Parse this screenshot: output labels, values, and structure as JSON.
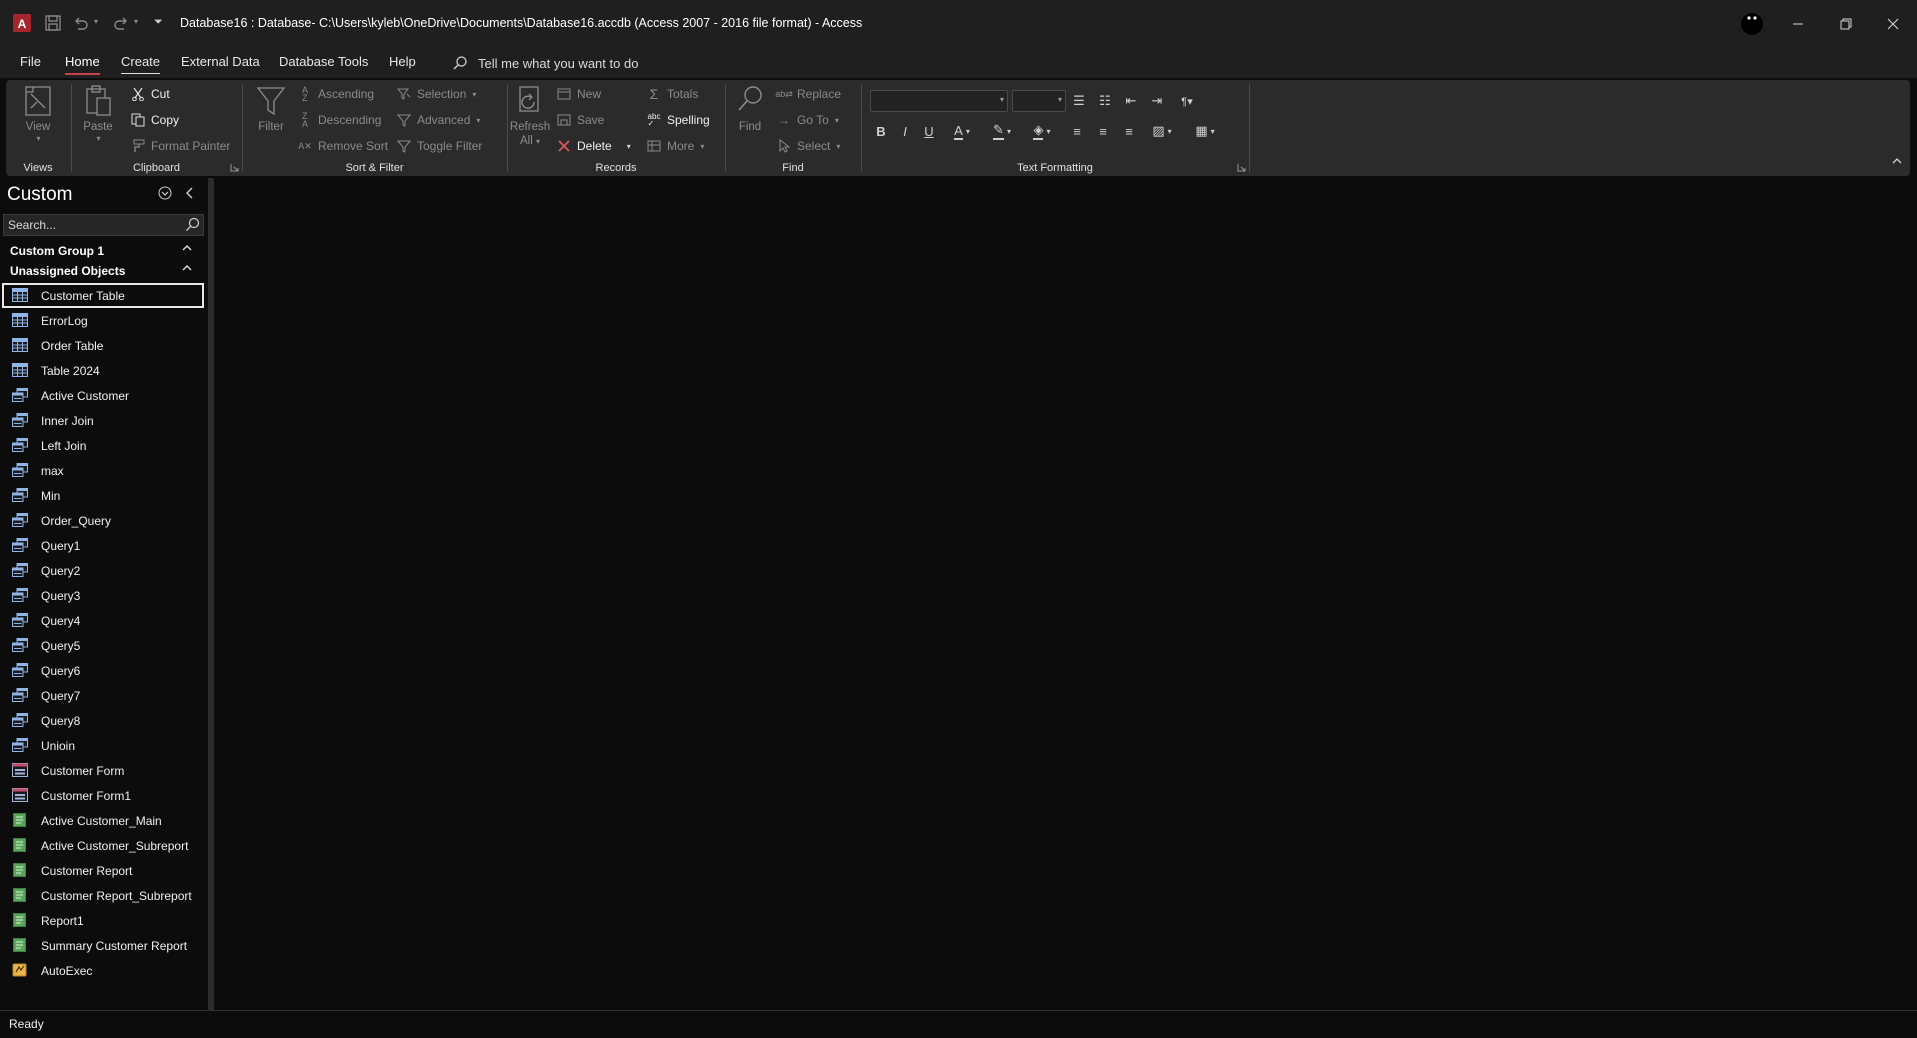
{
  "title_bar": {
    "title": "Database16 : Database- C:\\Users\\kyleb\\OneDrive\\Documents\\Database16.accdb (Access 2007 - 2016 file format)  -  Access"
  },
  "menu_tabs": [
    {
      "label": "File"
    },
    {
      "label": "Home",
      "active": true
    },
    {
      "label": "Create"
    },
    {
      "label": "External Data"
    },
    {
      "label": "Database Tools"
    },
    {
      "label": "Help"
    }
  ],
  "tell_me": {
    "text": "Tell me what you want to do"
  },
  "ribbon": {
    "views": {
      "group_label": "Views",
      "view": "View"
    },
    "clipboard": {
      "group_label": "Clipboard",
      "paste": "Paste",
      "cut": "Cut",
      "copy": "Copy",
      "format_painter": "Format Painter"
    },
    "sort_filter": {
      "group_label": "Sort & Filter",
      "filter": "Filter",
      "ascending": "Ascending",
      "descending": "Descending",
      "remove_sort": "Remove Sort",
      "selection": "Selection",
      "advanced": "Advanced",
      "toggle_filter": "Toggle Filter"
    },
    "records": {
      "group_label": "Records",
      "refresh": "Refresh",
      "refresh_all": "All",
      "new": "New",
      "save": "Save",
      "delete": "Delete",
      "totals": "Totals",
      "spelling": "Spelling",
      "more": "More"
    },
    "find": {
      "group_label": "Find",
      "find": "Find",
      "replace": "Replace",
      "go_to": "Go To",
      "select": "Select"
    },
    "text_formatting": {
      "group_label": "Text Formatting",
      "font_name": "",
      "font_size": ""
    }
  },
  "nav_pane": {
    "title": "Custom",
    "search_placeholder": "Search...",
    "groups": [
      {
        "label": "Custom Group 1"
      },
      {
        "label": "Unassigned Objects"
      }
    ],
    "items": [
      {
        "label": "Customer Table",
        "type": "table",
        "selected": true
      },
      {
        "label": "ErrorLog",
        "type": "table"
      },
      {
        "label": "Order Table",
        "type": "table"
      },
      {
        "label": "Table 2024",
        "type": "table"
      },
      {
        "label": "Active Customer",
        "type": "query"
      },
      {
        "label": "Inner Join",
        "type": "query"
      },
      {
        "label": "Left Join",
        "type": "query"
      },
      {
        "label": "max",
        "type": "query"
      },
      {
        "label": "Min",
        "type": "query"
      },
      {
        "label": "Order_Query",
        "type": "query"
      },
      {
        "label": "Query1",
        "type": "query"
      },
      {
        "label": "Query2",
        "type": "query"
      },
      {
        "label": "Query3",
        "type": "query"
      },
      {
        "label": "Query4",
        "type": "query"
      },
      {
        "label": "Query5",
        "type": "query"
      },
      {
        "label": "Query6",
        "type": "query"
      },
      {
        "label": "Query7",
        "type": "query"
      },
      {
        "label": "Query8",
        "type": "query"
      },
      {
        "label": "Unioin",
        "type": "query"
      },
      {
        "label": "Customer Form",
        "type": "form"
      },
      {
        "label": "Customer Form1",
        "type": "form"
      },
      {
        "label": "Active Customer_Main",
        "type": "report"
      },
      {
        "label": "Active Customer_Subreport",
        "type": "report"
      },
      {
        "label": "Customer Report",
        "type": "report"
      },
      {
        "label": "Customer Report_Subreport",
        "type": "report"
      },
      {
        "label": "Report1",
        "type": "report"
      },
      {
        "label": "Summary Customer Report",
        "type": "report"
      },
      {
        "label": "AutoExec",
        "type": "macro"
      }
    ]
  },
  "status_bar": {
    "text": "Ready"
  },
  "colors": {
    "accent": "#c8414a",
    "background": "#0c0c0c",
    "ribbon": "#2b2b2b",
    "titlebar": "#1f1f1f"
  }
}
